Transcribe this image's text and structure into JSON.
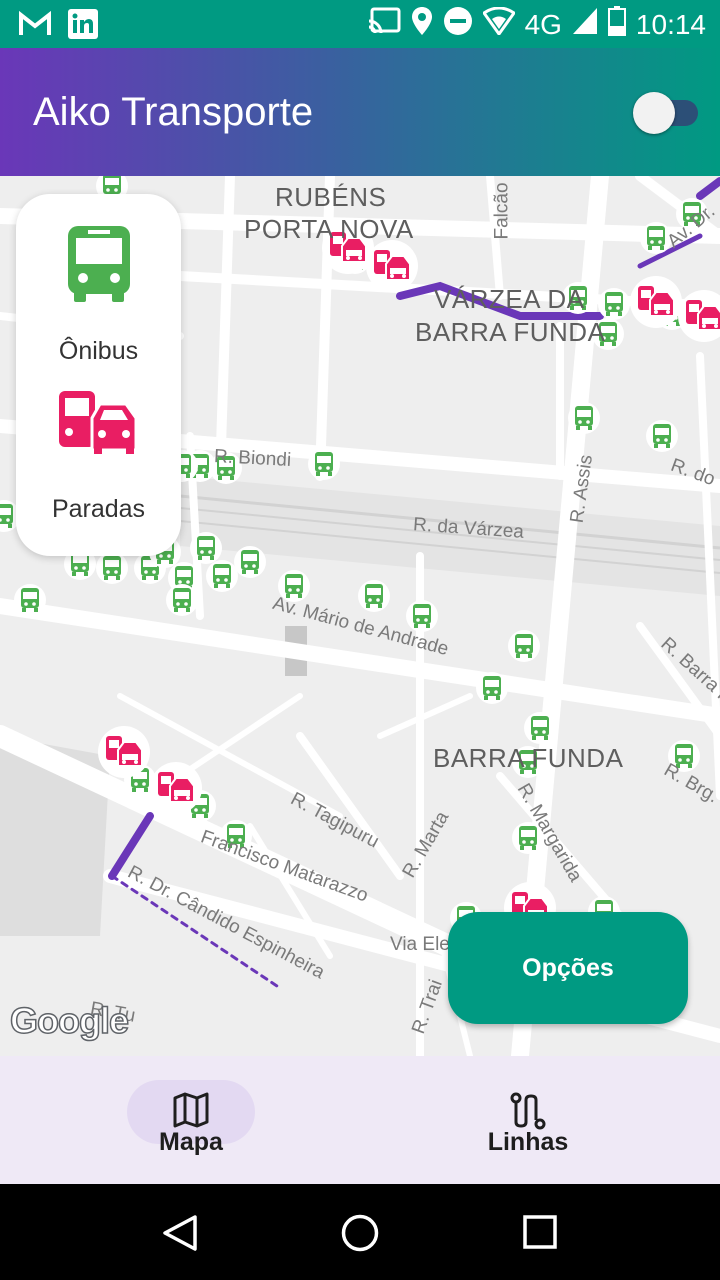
{
  "status_bar": {
    "time": "10:14",
    "network": "4G",
    "left_icons": [
      "gmail-icon",
      "linkedin-icon"
    ],
    "right_icons": [
      "cast-icon",
      "location-icon",
      "do-not-disturb-icon",
      "wifi-icon",
      "signal-icon",
      "battery-icon"
    ]
  },
  "app_bar": {
    "title": "Aiko Transporte",
    "toggle_on": false
  },
  "map": {
    "area_labels": [
      "RUBÉNS",
      "PORTA NOVA",
      "VÁRZEA DA",
      "BARRA FUNDA",
      "BARRA FUNDA"
    ],
    "street_labels": [
      "R. da Várzea",
      "R. Assis",
      "R. do",
      "Av. Mário de Andrade",
      "R. Barra F",
      "R. Tagipuru",
      "R. Marta",
      "R. Brg. G",
      "R. Margarida",
      "Francisco Matarazzo",
      "R. Dr. Cândido Espinheira",
      "Via Ele",
      "R. Trai",
      "Av. Dr.",
      "R. Biondi",
      "Falcão",
      "R. Tu"
    ],
    "attribution": "Google",
    "colors": {
      "bus_marker": "#4caf50",
      "stop_marker": "#e91e63",
      "route": "#6a37b8"
    }
  },
  "filter_panel": {
    "buses_label": "Ônibus",
    "stops_label": "Paradas"
  },
  "options_button": {
    "label": "Opções"
  },
  "bottom_nav": {
    "items": [
      {
        "label": "Mapa",
        "icon": "map-icon",
        "selected": true
      },
      {
        "label": "Linhas",
        "icon": "route-icon",
        "selected": false
      }
    ]
  },
  "system_nav": [
    "back-icon",
    "home-icon",
    "recents-icon"
  ]
}
